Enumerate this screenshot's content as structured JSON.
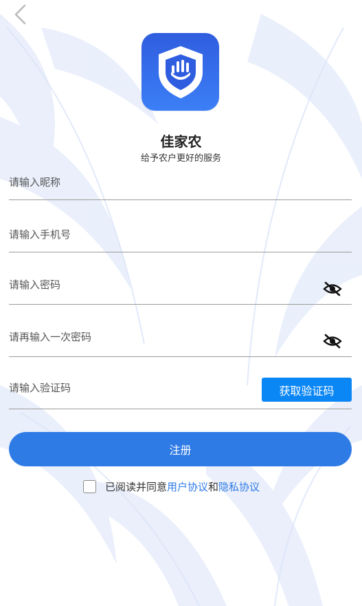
{
  "app": {
    "name": "佳家农",
    "slogan": "给予农户更好的服务"
  },
  "icons": {
    "back": "chevron-left-icon",
    "logo": "shield-hand-icon",
    "password_visibility": "eye-off-icon"
  },
  "form": {
    "nickname_placeholder": "请输入昵称",
    "phone_placeholder": "请输入手机号",
    "password_placeholder": "请输入密码",
    "confirm_password_placeholder": "请再输入一次密码",
    "code_placeholder": "请输入验证码",
    "get_code_label": "获取验证码"
  },
  "register_label": "注册",
  "agreement": {
    "prefix": "已阅读并同意",
    "user_agreement": "用户协议",
    "conjunction": "和",
    "privacy_agreement": "隐私协议",
    "checked": false
  },
  "colors": {
    "primary": "#2f7be6",
    "code_button": "#0a86f5",
    "logo_gradient_top": "#2f5ddf",
    "logo_gradient_bottom": "#3c7ff6",
    "background_pattern": "#e3ebfb"
  }
}
